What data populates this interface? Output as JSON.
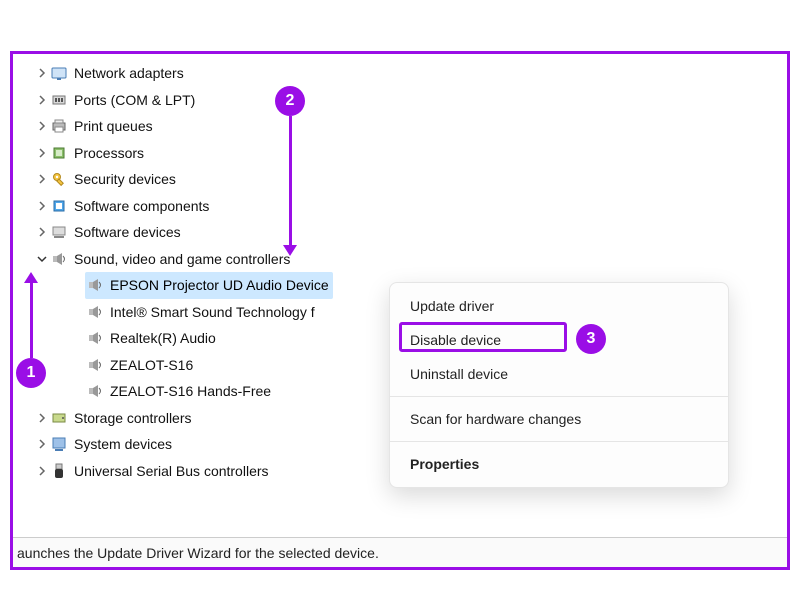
{
  "tree": {
    "categories": [
      {
        "label": "Network adapters",
        "icon": "network"
      },
      {
        "label": "Ports (COM & LPT)",
        "icon": "port"
      },
      {
        "label": "Print queues",
        "icon": "printer"
      },
      {
        "label": "Processors",
        "icon": "cpu"
      },
      {
        "label": "Security devices",
        "icon": "security"
      },
      {
        "label": "Software components",
        "icon": "swcomp"
      },
      {
        "label": "Software devices",
        "icon": "swdev"
      }
    ],
    "expanded": {
      "label": "Sound, video and game controllers",
      "icon": "sound",
      "children": [
        {
          "label": "EPSON Projector UD Audio Device",
          "selected": true
        },
        {
          "label": "Intel® Smart Sound Technology f",
          "selected": false
        },
        {
          "label": "Realtek(R) Audio",
          "selected": false
        },
        {
          "label": "ZEALOT-S16",
          "selected": false
        },
        {
          "label": "ZEALOT-S16 Hands-Free",
          "selected": false
        }
      ]
    },
    "categories_after": [
      {
        "label": "Storage controllers",
        "icon": "storage"
      },
      {
        "label": "System devices",
        "icon": "system"
      },
      {
        "label": "Universal Serial Bus controllers",
        "icon": "usb"
      }
    ]
  },
  "context_menu": {
    "items": [
      {
        "label": "Update driver"
      },
      {
        "label": "Disable device",
        "highlighted": true
      },
      {
        "label": "Uninstall device"
      }
    ],
    "items_after_sep": [
      {
        "label": "Scan for hardware changes"
      }
    ],
    "last": {
      "label": "Properties"
    }
  },
  "status_text": "aunches the Update Driver Wizard for the selected device.",
  "annotations": {
    "a1": "1",
    "a2": "2",
    "a3": "3"
  }
}
